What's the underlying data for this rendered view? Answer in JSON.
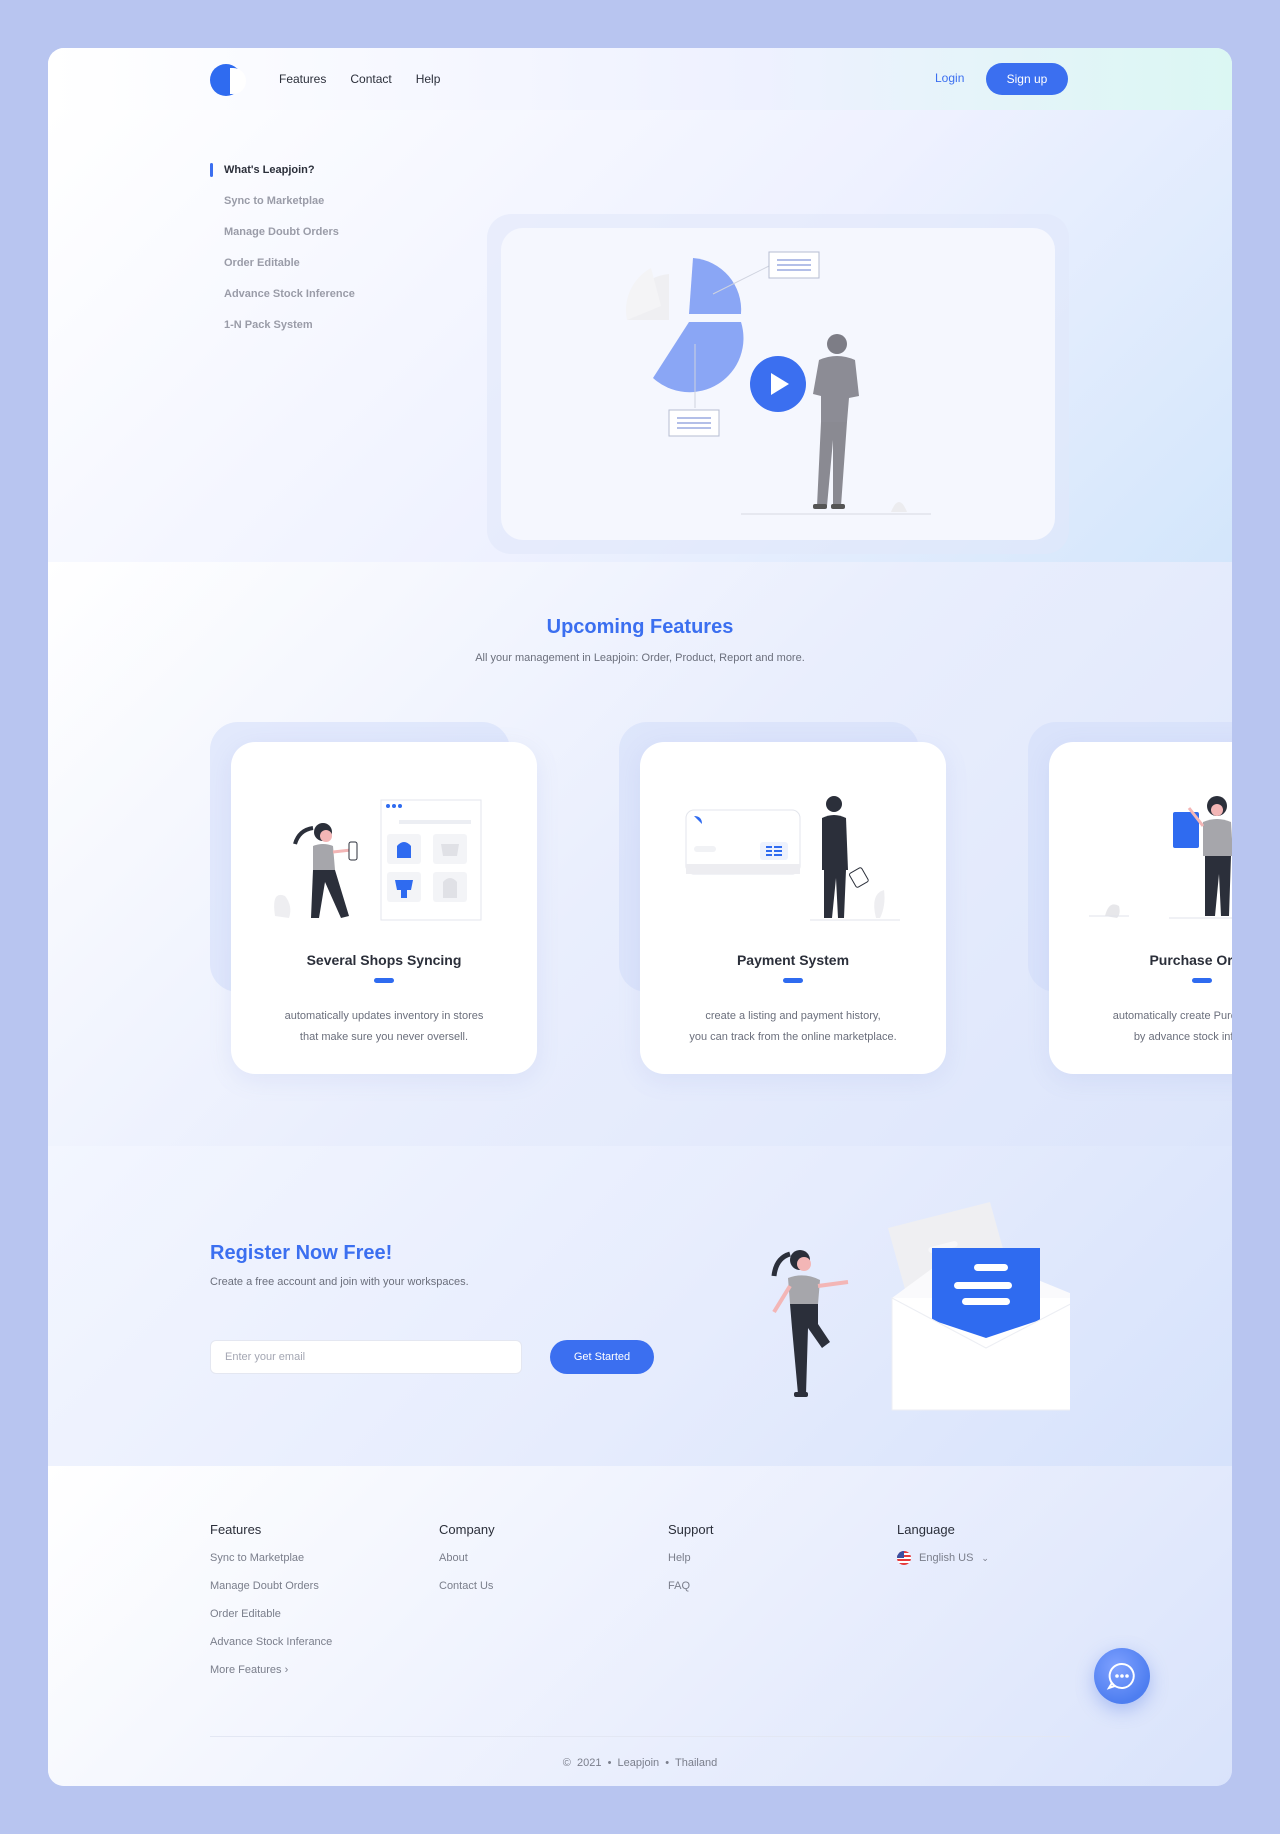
{
  "header": {
    "nav": [
      "Features",
      "Contact",
      "Help"
    ],
    "login": "Login",
    "signup": "Sign up"
  },
  "hero": {
    "toc": [
      "What's Leapjoin?",
      "Sync to Marketplae",
      "Manage Doubt Orders",
      "Order Editable",
      "Advance Stock Inference",
      "1-N Pack System"
    ],
    "video_icon": "play-icon"
  },
  "features": {
    "title": "Upcoming Features",
    "subtitle": "All your management in Leapjoin: Order, Product, Report and more.",
    "cards": [
      {
        "title": "Several Shops Syncing",
        "line1": "automatically updates inventory in stores",
        "line2": "that make sure you never oversell."
      },
      {
        "title": "Payment System",
        "line1": "create a listing and payment history,",
        "line2": "you can track from the online marketplace."
      },
      {
        "title": "Purchase Order",
        "line1": "automatically create Purchase Order",
        "line2": "by advance stock inference."
      }
    ]
  },
  "register": {
    "title": "Register Now Free!",
    "subtitle": "Create a free account and join with your workspaces.",
    "email_placeholder": "Enter your email",
    "email_value": "",
    "cta": "Get Started"
  },
  "footer": {
    "features": {
      "heading": "Features",
      "links": [
        "Sync to Marketplae",
        "Manage Doubt Orders",
        "Order Editable",
        "Advance Stock Inferance",
        "More Features"
      ]
    },
    "company": {
      "heading": "Company",
      "links": [
        "About",
        "Contact Us"
      ]
    },
    "support": {
      "heading": "Support",
      "links": [
        "Help",
        "FAQ"
      ]
    },
    "language": {
      "heading": "Language",
      "selected": "English US"
    },
    "copyright": {
      "year": "2021",
      "company": "Leapjoin",
      "country": "Thailand"
    }
  },
  "colors": {
    "accent": "#3b6ff0",
    "logo": "#2f6bf0",
    "bar": "#2f6bf0"
  }
}
